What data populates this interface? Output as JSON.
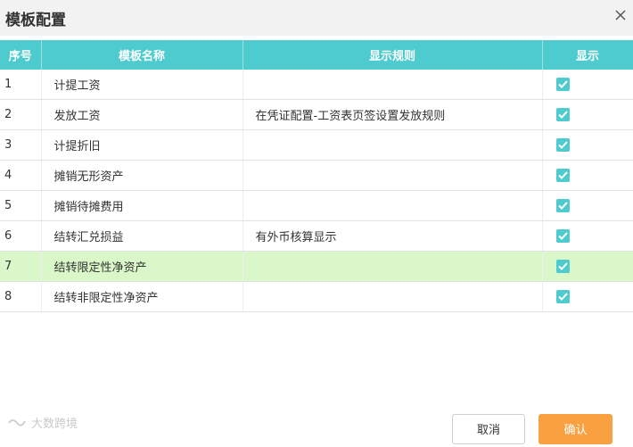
{
  "dialog": {
    "title": "模板配置",
    "close_icon": "close-icon"
  },
  "table": {
    "headers": {
      "seq": "序号",
      "name": "模板名称",
      "rule": "显示规则",
      "show": "显示"
    },
    "rows": [
      {
        "seq": "1",
        "name": "计提工资",
        "rule": "",
        "show": true
      },
      {
        "seq": "2",
        "name": "发放工资",
        "rule": "在凭证配置-工资表页签设置发放规则",
        "show": true
      },
      {
        "seq": "3",
        "name": "计提折旧",
        "rule": "",
        "show": true
      },
      {
        "seq": "4",
        "name": "摊销无形资产",
        "rule": "",
        "show": true
      },
      {
        "seq": "5",
        "name": "摊销待摊费用",
        "rule": "",
        "show": true
      },
      {
        "seq": "6",
        "name": "结转汇兑损益",
        "rule": "有外币核算显示",
        "show": true
      },
      {
        "seq": "7",
        "name": "结转限定性净资产",
        "rule": "",
        "show": true,
        "selected": true
      },
      {
        "seq": "8",
        "name": "结转非限定性净资产",
        "rule": "",
        "show": true
      }
    ]
  },
  "footer": {
    "watermark": "大数跨境",
    "cancel_label": "取消",
    "ok_label": "确认"
  },
  "colors": {
    "header_bg": "#4ecbcf",
    "selected_row_bg": "#d9f7c8",
    "ok_button_bg": "#f9a041"
  }
}
